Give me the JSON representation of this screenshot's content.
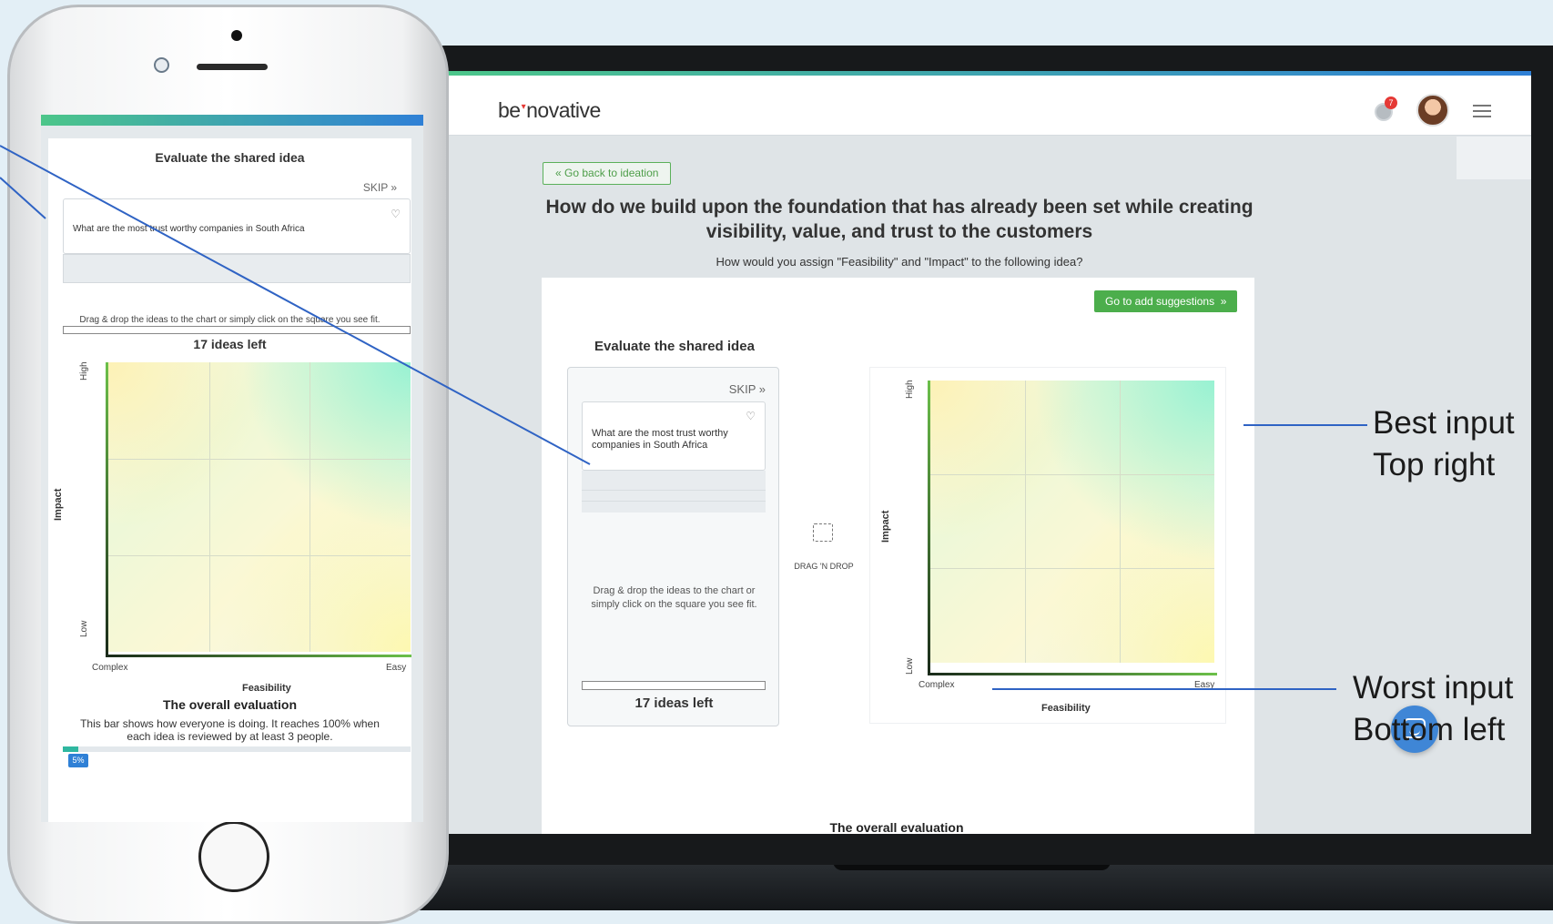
{
  "header": {
    "logo": "be·novative",
    "notification_count": "7"
  },
  "main": {
    "back_button": "Go back to ideation",
    "question": "How do we build upon the foundation that has already been set while creating visibility, value, and trust to the customers",
    "sub_question": "How would you assign \"Feasibility\" and \"Impact\" to the following idea?",
    "add_suggestions_button": "Go to add suggestions",
    "card_title": "Evaluate the shared idea",
    "skip": "SKIP »",
    "idea_text": "What are the most trust worthy companies in South Africa",
    "instructions": "Drag & drop the ideas to the chart or simply click on the square you see fit.",
    "ideas_left": "17 ideas left",
    "drag_label": "DRAG 'N DROP",
    "overall_title": "The overall evaluation"
  },
  "matrix": {
    "y_axis_title": "Impact",
    "y_high": "High",
    "y_low": "Low",
    "x_axis_title": "Feasibility",
    "x_low": "Complex",
    "x_high": "Easy",
    "grid": "3x3"
  },
  "phone": {
    "title": "Evaluate the shared idea",
    "skip": "SKIP »",
    "idea_text": "What are the most trust worthy companies in South Africa",
    "instructions": "Drag & drop the ideas to the chart or simply click on the square you see fit.",
    "ideas_left": "17 ideas left",
    "overall_title": "The overall evaluation",
    "overall_desc": "This bar shows how everyone is doing. It reaches 100% when each idea is reviewed by at least 3 people.",
    "progress_percent": "5%",
    "progress_value": 0.05
  },
  "annotations": {
    "best_line1": "Best input",
    "best_line2": "Top right",
    "worst_line1": "Worst input",
    "worst_line2": "Bottom left"
  },
  "colors": {
    "accent_green": "#4cae4c",
    "top_gradient_start": "#4cc68a",
    "top_gradient_end": "#2f80d6",
    "annotation_line": "#2f63c4",
    "chat_button": "#3f86d6"
  }
}
